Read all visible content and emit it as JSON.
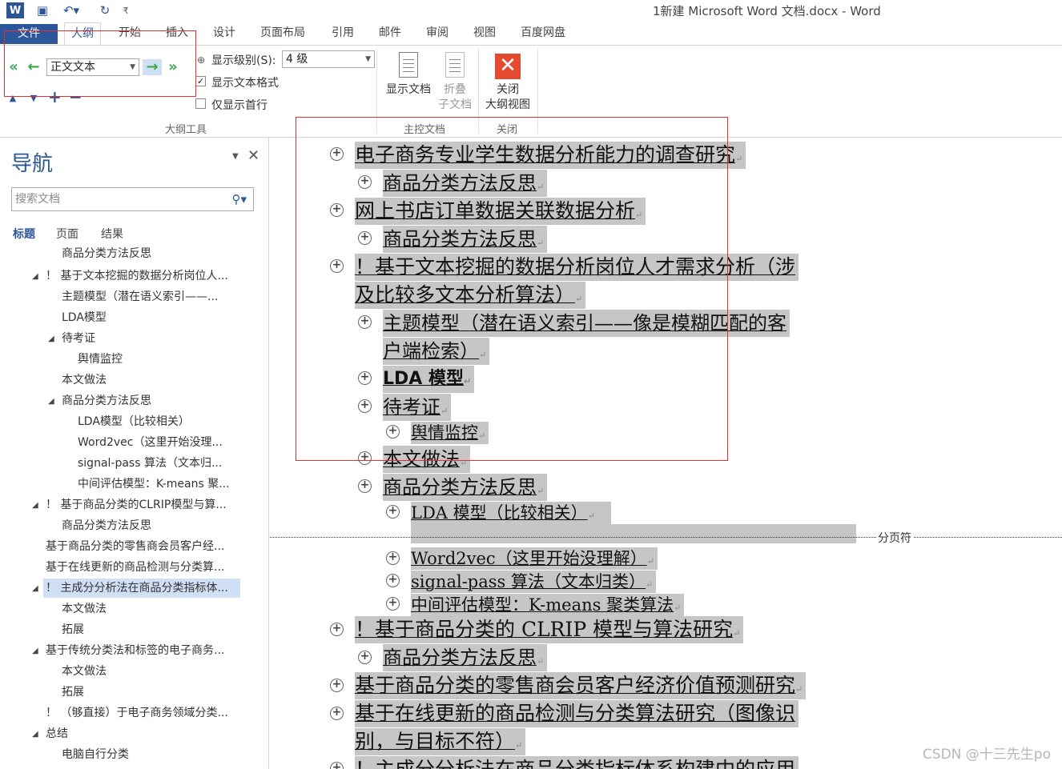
{
  "title_bar": {
    "title": "1新建 Microsoft Word 文档.docx - Word",
    "customize_symbol": "₹"
  },
  "tabs": [
    "文件",
    "大纲",
    "开始",
    "插入",
    "设计",
    "页面布局",
    "引用",
    "邮件",
    "审阅",
    "视图",
    "百度网盘"
  ],
  "ribbon": {
    "level_select": "正文文本",
    "show_level_label": "显示级别(S):",
    "show_level_value": "4 级",
    "show_text_format": "显示文本格式",
    "show_first_line": "仅显示首行",
    "show_doc": "显示文档",
    "collapse_sub_1": "折叠",
    "collapse_sub_2": "子文档",
    "close_1": "关闭",
    "close_2": "大纲视图",
    "group_outline_tools": "大纲工具",
    "group_master_doc": "主控文档",
    "group_close": "关闭"
  },
  "nav": {
    "title": "导航",
    "search_placeholder": "搜索文档",
    "tabs": [
      "标题",
      "页面",
      "结果"
    ],
    "items": [
      "商品分类方法反思",
      "！ 基于文本挖掘的数据分析岗位人...",
      "主题模型（潜在语义索引——...",
      "LDA模型",
      "待考证",
      "舆情监控",
      "本文做法",
      "商品分类方法反思",
      "LDA模型（比较相关）",
      "Word2vec（这里开始没理...",
      "signal-pass 算法（文本归...",
      "中间评估模型：K-means 聚...",
      "！ 基于商品分类的CLRIP模型与算...",
      "商品分类方法反思",
      "基于商品分类的零售商会员客户经...",
      "基于在线更新的商品检测与分类算...",
      "！ 主成分分析法在商品分类指标体...",
      "本文做法",
      "拓展",
      "基于传统分类法和标签的电子商务...",
      "本文做法",
      "拓展",
      "！ （够直接）于电子商务领域分类...",
      "总结",
      "电脑自行分类"
    ]
  },
  "doc": {
    "lines": [
      "电子商务专业学生数据分析能力的调查研究",
      "商品分类方法反思",
      "网上书店订单数据关联数据分析",
      "商品分类方法反思",
      "！基于文本挖掘的数据分析岗位人才需求分析（涉",
      "及比较多文本分析算法）",
      "主题模型（潜在语义索引——像是模糊匹配的客",
      "户端检索）",
      "LDA 模型",
      "待考证",
      "舆情监控",
      "本文做法",
      "商品分类方法反思",
      "LDA 模型（比较相关）",
      "Word2vec（这里开始没理解）",
      "signal-pass 算法（文本归类）",
      "中间评估模型：K-means 聚类算法",
      "！基于商品分类的 CLRIP 模型与算法研究",
      "商品分类方法反思",
      "基于商品分类的零售商会员客户经济价值预测研究",
      "基于在线更新的商品检测与分类算法研究（图像识",
      "别，与目标不符）",
      "！主成分分析法在商品分类指标体系构建中的应用"
    ],
    "page_break": "分页符",
    "para_mark": "↵",
    "plus": "+"
  },
  "watermark": "CSDN @十三先生po",
  "colors": {
    "accent": "#2b579a",
    "highlight": "#c6c6c6",
    "annotation": "#e03030"
  }
}
